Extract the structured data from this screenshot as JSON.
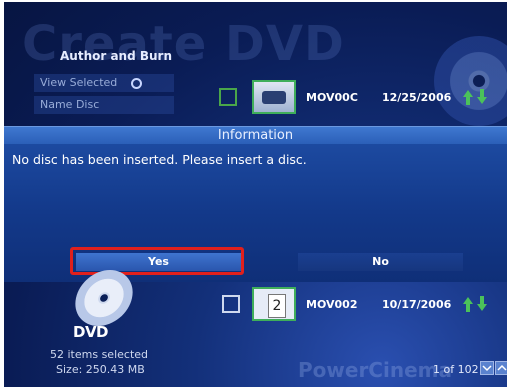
{
  "background_title": "Create DVD",
  "menu": {
    "title": "Author and Burn",
    "items": [
      "View Selected",
      "Name Disc"
    ]
  },
  "rows": [
    {
      "thumb": "",
      "name": "MOV00C",
      "date": "12/25/2006"
    },
    {
      "thumb": "2",
      "name": "MOV002",
      "date": "10/17/2006"
    }
  ],
  "dialog": {
    "title": "Information",
    "message": "No disc has been inserted. Please insert a disc.",
    "yes_label": "Yes",
    "no_label": "No"
  },
  "footer": {
    "dvd_logo": "DVD",
    "selected_text": "52 items selected",
    "size_text": "Size: 250.43 MB",
    "brand": "PowerCinema",
    "pager": "1 of 102"
  },
  "colors": {
    "background": "#0a1c55",
    "dialog": "#1f4ea6",
    "highlight": "#e0201c",
    "arrows": "#4bc25a"
  }
}
